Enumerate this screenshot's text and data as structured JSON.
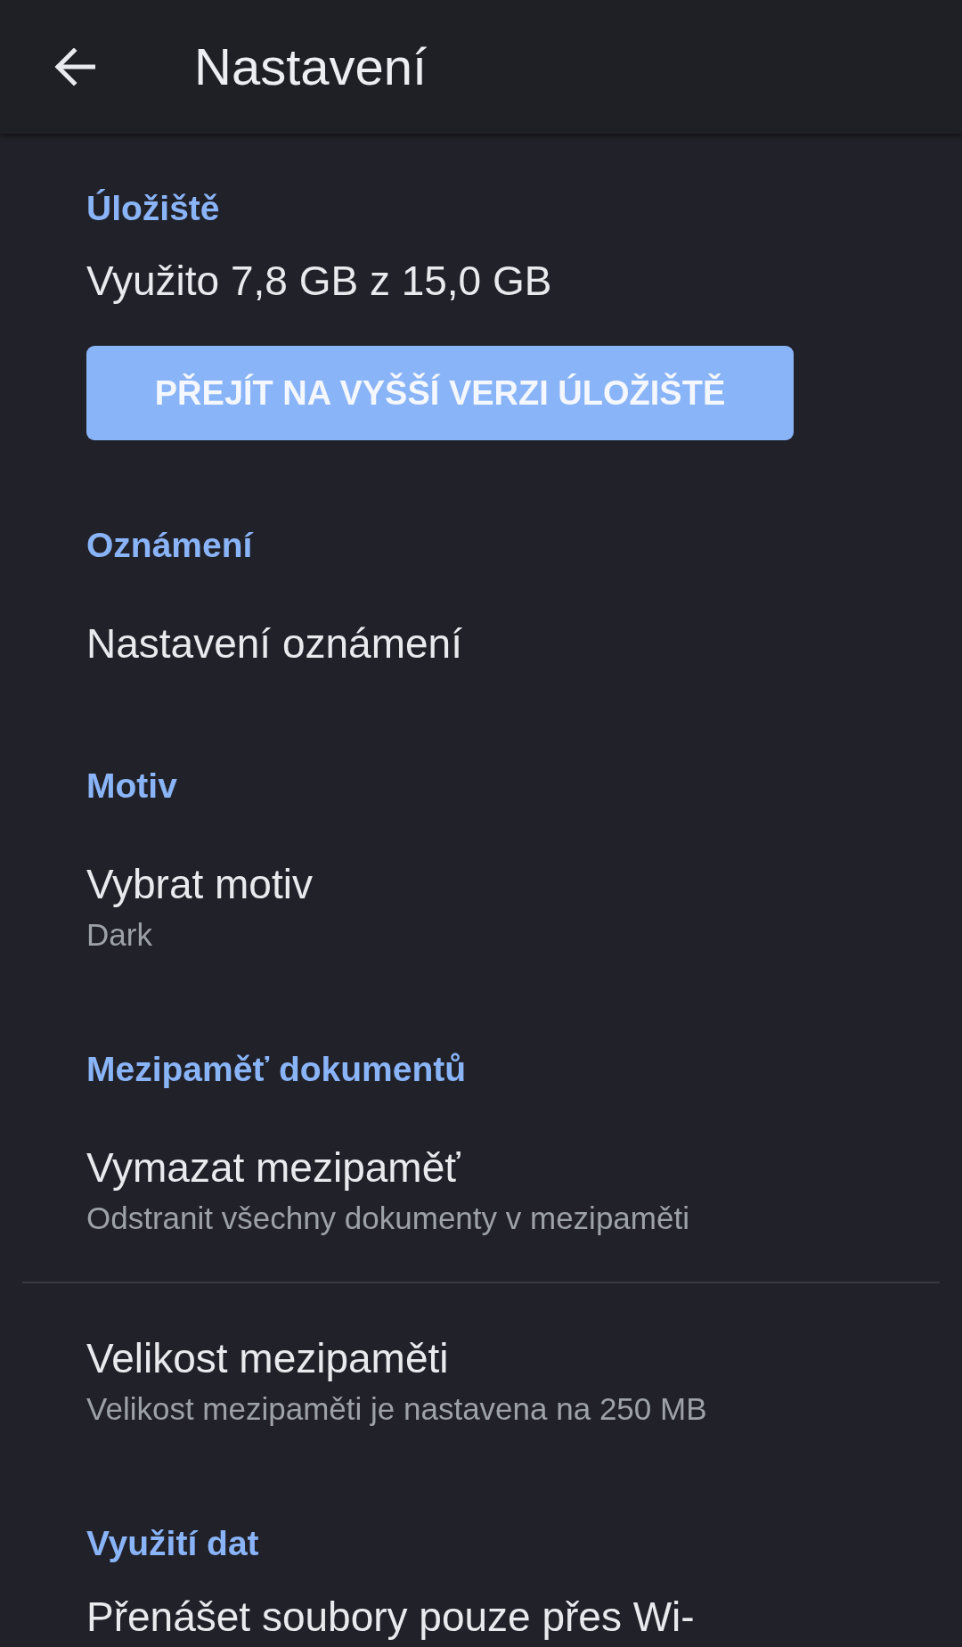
{
  "toolbar": {
    "title": "Nastavení"
  },
  "sections": [
    {
      "header": "Úložiště",
      "items": [
        {
          "kind": "info",
          "text": "Využito 7,8 GB z 15,0 GB"
        },
        {
          "kind": "button",
          "label": "PŘEJÍT NA VYŠŠÍ VERZI ÚLOŽIŠTĚ"
        }
      ]
    },
    {
      "header": "Oznámení",
      "items": [
        {
          "kind": "pref",
          "title": "Nastavení oznámení"
        }
      ]
    },
    {
      "header": "Motiv",
      "items": [
        {
          "kind": "pref",
          "title": "Vybrat motiv",
          "summary": "Dark"
        }
      ]
    },
    {
      "header": "Mezipaměť dokumentů",
      "items": [
        {
          "kind": "pref",
          "title": "Vymazat mezipaměť",
          "summary": "Odstranit všechny dokumenty v mezipaměti"
        },
        {
          "kind": "divider"
        },
        {
          "kind": "pref",
          "title": "Velikost mezipaměti",
          "summary": "Velikost mezipaměti je nastavena na 250 MB"
        }
      ]
    },
    {
      "header": "Využití dat",
      "items": [
        {
          "kind": "pref",
          "title": "Přenášet soubory pouze přes Wi-"
        }
      ]
    }
  ]
}
